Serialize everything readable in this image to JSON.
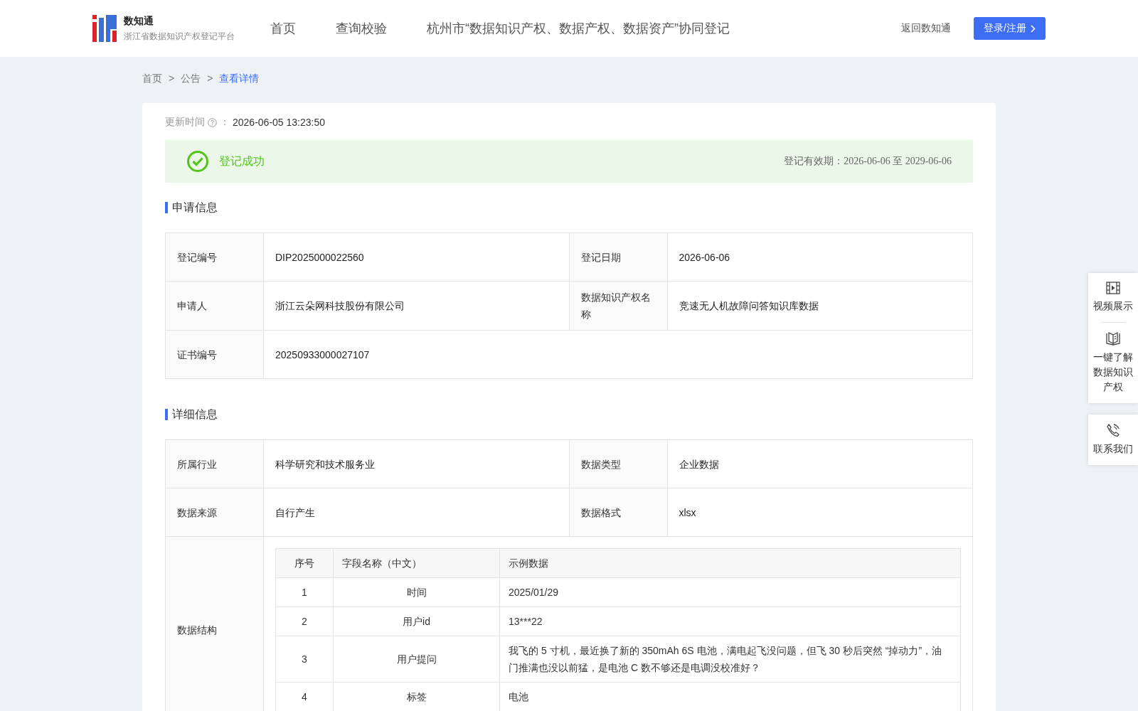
{
  "header": {
    "logo": {
      "title": "数知通",
      "subtitle": "浙江省数据知识产权登记平台"
    },
    "nav": [
      {
        "label": "首页",
        "selected": false
      },
      {
        "label": "查询校验",
        "selected": false
      },
      {
        "label": "杭州市“数据知识产权、数据产权、数据资产”协同登记",
        "selected": false
      }
    ],
    "back_link": "返回数知通",
    "login_button": "登录/注册"
  },
  "breadcrumb": [
    {
      "label": "首页",
      "current": false
    },
    {
      "label": "公告",
      "current": false
    },
    {
      "label": "查看详情",
      "current": true
    }
  ],
  "breadcrumb_separator": ">",
  "update": {
    "label": "更新时间",
    "colon": "：",
    "value": "2026-06-05 13:23:50"
  },
  "status": {
    "kind": "success",
    "text": "登记成功",
    "validity": "登记有效期：2026-06-06 至 2029-06-06"
  },
  "sections": [
    {
      "title": "申请信息",
      "rows": [
        {
          "kind": "pair",
          "fields": [
            {
              "label": "登记编号",
              "value": "DIP2025000022560"
            },
            {
              "label": "登记日期",
              "value": "2026-06-06"
            }
          ]
        },
        {
          "kind": "pair",
          "fields": [
            {
              "label": "申请人",
              "value": "浙江云朵网科技股份有限公司"
            },
            {
              "label": "数据知识产权名称",
              "value": "竞速无人机故障问答知识库数据"
            }
          ]
        },
        {
          "kind": "single",
          "fields": [
            {
              "label": "证书编号",
              "value": "20250933000027107"
            }
          ]
        }
      ]
    },
    {
      "title": "详细信息",
      "rows": [
        {
          "kind": "pair",
          "fields": [
            {
              "label": "所属行业",
              "value": "科学研究和技术服务业"
            },
            {
              "label": "数据类型",
              "value": "企业数据"
            }
          ]
        },
        {
          "kind": "pair",
          "fields": [
            {
              "label": "数据来源",
              "value": "自行产生"
            },
            {
              "label": "数据格式",
              "value": "xlsx"
            }
          ]
        },
        {
          "kind": "table",
          "label": "数据结构",
          "table": {
            "columns": [
              "序号",
              "字段名称（中文）",
              "示例数据"
            ],
            "rows": [
              [
                "1",
                "时间",
                "2025/01/29"
              ],
              [
                "2",
                "用户id",
                "13***22"
              ],
              [
                "3",
                "用户提问",
                "我飞的 5 寸机，最近换了新的 350mAh 6S 电池，满电起飞没问题，但飞 30 秒后突然 “掉动力”，油门推满也没以前猛，是电池 C 数不够还是电调没校准好？"
              ],
              [
                "4",
                "标签",
                "电池"
              ]
            ]
          }
        }
      ]
    }
  ],
  "side_panel": [
    {
      "items": [
        {
          "kind": "video",
          "label": "视频展示"
        },
        {
          "kind": "guide",
          "label": "一键了解数据知识产权"
        }
      ]
    },
    {
      "items": [
        {
          "kind": "contact",
          "label": "联系我们"
        }
      ]
    }
  ]
}
